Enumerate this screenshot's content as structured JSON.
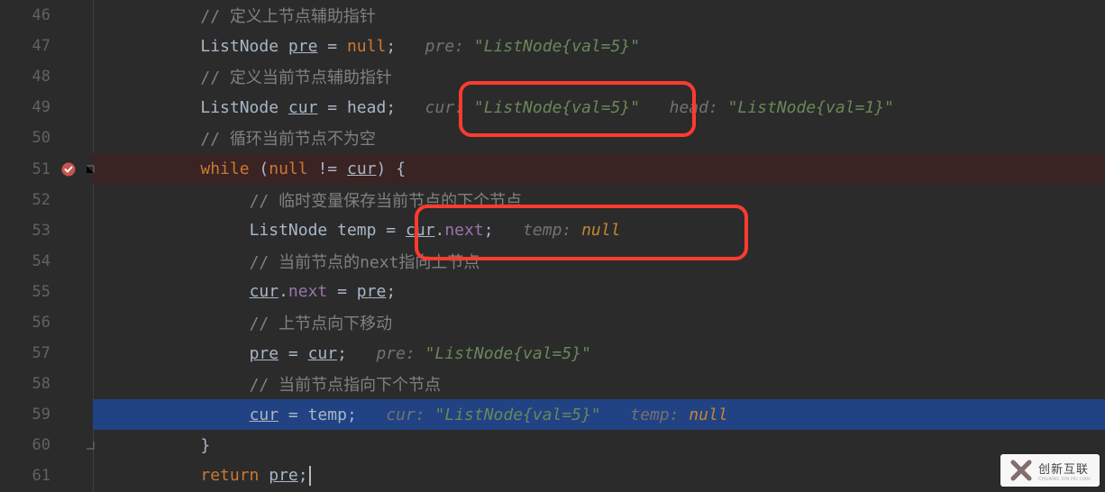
{
  "gutter": {
    "start": 46,
    "end": 61
  },
  "lines": {
    "46": {
      "comment": "// 定义上节点辅助指针"
    },
    "47": {
      "type": "ListNode",
      "var": "pre",
      "assign": "null",
      "hint_label": "pre:",
      "hint_val": "\"ListNode{val=5}\""
    },
    "48": {
      "comment": "// 定义当前节点辅助指针"
    },
    "49": {
      "type": "ListNode",
      "var": "cur",
      "assign": "head",
      "hint1_label": "cur:",
      "hint1_val": "\"ListNode{val=5}\"",
      "hint2_label": "head:",
      "hint2_val": "\"ListNode{val=1}\""
    },
    "50": {
      "comment": "// 循环当前节点不为空"
    },
    "51": {
      "kw": "while",
      "cond_left": "null",
      "cond_op": "!=",
      "cond_right": "cur",
      "brace": "{"
    },
    "52": {
      "comment": "// 临时变量保存当前节点的下个节点"
    },
    "53": {
      "type": "ListNode",
      "var": "temp",
      "expr_obj": "cur",
      "expr_field": "next",
      "hint_label": "temp:",
      "hint_val": "null"
    },
    "54": {
      "comment": "// 当前节点的next指向上节点"
    },
    "55": {
      "lhs_obj": "cur",
      "lhs_field": "next",
      "rhs": "pre"
    },
    "56": {
      "comment": "// 上节点向下移动"
    },
    "57": {
      "lhs": "pre",
      "rhs": "cur",
      "hint_label": "pre:",
      "hint_val": "\"ListNode{val=5}\""
    },
    "58": {
      "comment": "// 当前节点指向下个节点"
    },
    "59": {
      "lhs": "cur",
      "rhs": "temp",
      "hint1_label": "cur:",
      "hint1_val": "\"ListNode{val=5}\"",
      "hint2_label": "temp:",
      "hint2_val": "null"
    },
    "60": {
      "brace": "}"
    },
    "61": {
      "kw": "return",
      "var": "pre"
    }
  },
  "watermark": {
    "brand": "创新互联",
    "sub": "CHUANG XIN HU LIAN"
  }
}
